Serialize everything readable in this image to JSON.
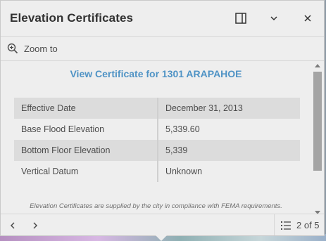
{
  "popup": {
    "title": "Elevation Certificates",
    "dock_icon": "dock-icon",
    "collapse_icon": "chevron-down-icon",
    "close_icon": "close-icon"
  },
  "toolbar": {
    "zoom_label": "Zoom to",
    "zoom_icon": "zoom-in-icon"
  },
  "content": {
    "link_text": "View Certificate for 1301 ARAPAHOE",
    "rows": [
      {
        "label": "Effective Date",
        "value": "December 31, 2013"
      },
      {
        "label": "Base Flood Elevation",
        "value": "5,339.60"
      },
      {
        "label": "Bottom Floor Elevation",
        "value": "5,339"
      },
      {
        "label": "Vertical Datum",
        "value": "Unknown"
      }
    ],
    "footnote": "Elevation Certificates are supplied by the city in compliance with FEMA requirements."
  },
  "footer": {
    "page_label": "2 of 5",
    "prev_icon": "chevron-left-icon",
    "next_icon": "chevron-right-icon",
    "list_icon": "list-icon"
  },
  "colors": {
    "accent": "#4f93c5",
    "panel": "#eeeeee"
  }
}
